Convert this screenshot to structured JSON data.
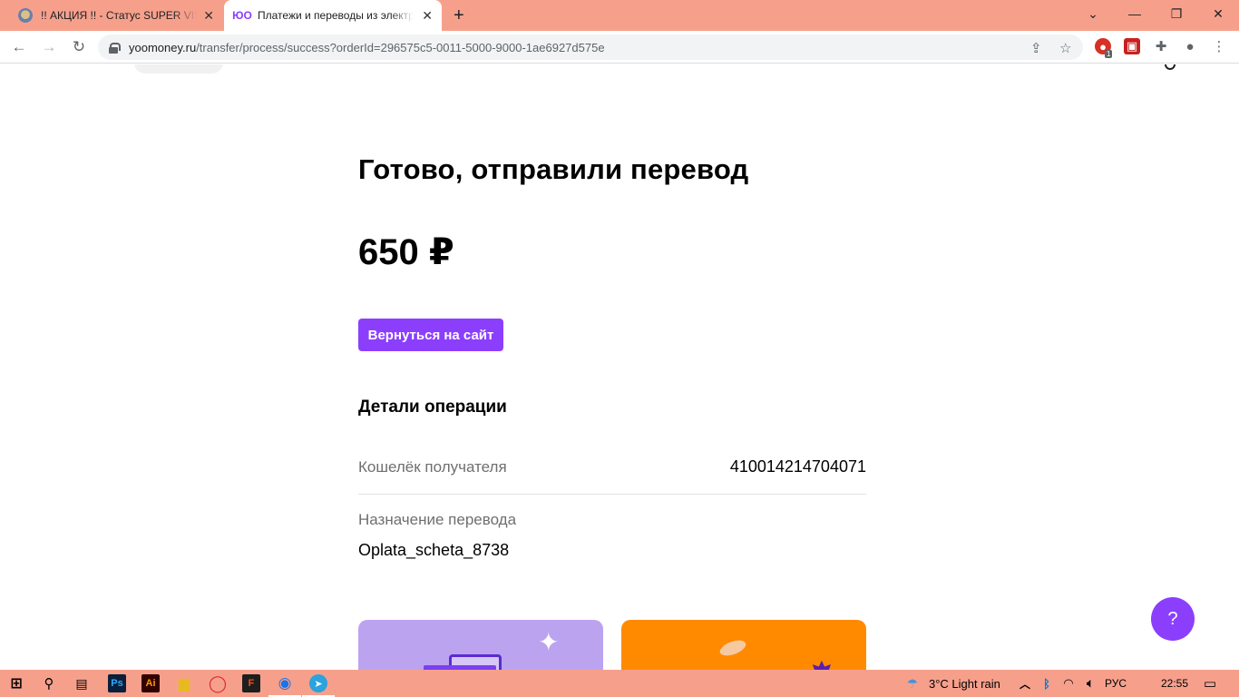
{
  "browser": {
    "tabs": [
      {
        "title": "!! АКЦИЯ !! - Статус SUPER VIP с",
        "active": false
      },
      {
        "title": "Платежи и переводы из электр",
        "active": true
      }
    ],
    "url_host": "yoomoney.ru",
    "url_path": "/transfer/process/success?orderId=296575c5-0011-5000-9000-1ae6927d575e",
    "extension_badge": "1"
  },
  "page": {
    "headline": "Готово, отправили перевод",
    "amount": "650 ₽",
    "back_button": "Вернуться на сайт",
    "details_title": "Детали операции",
    "recipient_wallet_label": "Кошелёк получателя",
    "recipient_wallet_value": "410014214704071",
    "purpose_label": "Назначение перевода",
    "purpose_value": "Oplata_scheta_8738",
    "help_button": "?",
    "accent_color": "#8b3ffd"
  },
  "taskbar": {
    "weather": "3°C  Light rain",
    "language": "РУС",
    "time": "22:55"
  }
}
